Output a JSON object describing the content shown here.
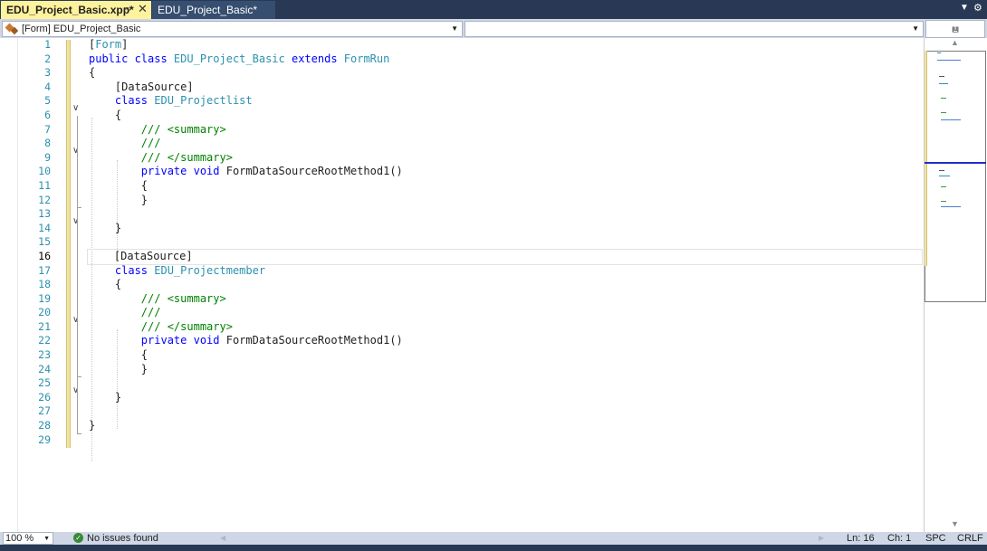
{
  "tabs": [
    {
      "label": "EDU_Project_Basic.xpp*",
      "active": true,
      "pin_icon": "pin-icon",
      "close_icon": "close-icon"
    },
    {
      "label": "EDU_Project_Basic*",
      "active": false
    }
  ],
  "tabstrip": {
    "menu_icon": "dropdown-arrow-icon",
    "settings_icon": "gear-icon"
  },
  "navbar": {
    "left_combo": "[Form] EDU_Project_Basic",
    "right_combo": "",
    "split_icon": "split-window-icon"
  },
  "editor": {
    "current_line": 16,
    "lines": [
      {
        "n": "1",
        "tokens": [
          {
            "t": "[",
            "c": "br"
          },
          {
            "t": "Form",
            "c": "ty"
          },
          {
            "t": "]",
            "c": "br"
          }
        ]
      },
      {
        "n": "2",
        "tokens": [
          {
            "t": "public class ",
            "c": "kw"
          },
          {
            "t": "EDU_Project_Basic",
            "c": "ty"
          },
          {
            "t": " extends ",
            "c": "kw"
          },
          {
            "t": "FormRun",
            "c": "ty"
          }
        ]
      },
      {
        "n": "3",
        "tokens": [
          {
            "t": "{",
            "c": "br"
          }
        ]
      },
      {
        "n": "4",
        "tokens": [
          {
            "t": "    [DataSource]",
            "c": "br"
          }
        ]
      },
      {
        "n": "5",
        "tokens": [
          {
            "t": "    class ",
            "c": "kw"
          },
          {
            "t": "EDU_Projectlist",
            "c": "ty"
          }
        ]
      },
      {
        "n": "6",
        "tokens": [
          {
            "t": "    {",
            "c": "br"
          }
        ]
      },
      {
        "n": "7",
        "tokens": [
          {
            "t": "        /// <summary>",
            "c": "cm"
          }
        ]
      },
      {
        "n": "8",
        "tokens": [
          {
            "t": "        ///",
            "c": "cm"
          }
        ]
      },
      {
        "n": "9",
        "tokens": [
          {
            "t": "        /// </summary>",
            "c": "cm"
          }
        ]
      },
      {
        "n": "10",
        "tokens": [
          {
            "t": "        private void ",
            "c": "kw"
          },
          {
            "t": "FormDataSourceRootMethod1()",
            "c": "br"
          }
        ]
      },
      {
        "n": "11",
        "tokens": [
          {
            "t": "        {",
            "c": "br"
          }
        ]
      },
      {
        "n": "12",
        "tokens": [
          {
            "t": "        }",
            "c": "br"
          }
        ]
      },
      {
        "n": "13",
        "tokens": []
      },
      {
        "n": "14",
        "tokens": [
          {
            "t": "    }",
            "c": "br"
          }
        ]
      },
      {
        "n": "15",
        "tokens": []
      },
      {
        "n": "16",
        "tokens": [
          {
            "t": "    [DataSource]",
            "c": "br"
          }
        ]
      },
      {
        "n": "17",
        "tokens": [
          {
            "t": "    class ",
            "c": "kw"
          },
          {
            "t": "EDU_Projectmember",
            "c": "ty"
          }
        ]
      },
      {
        "n": "18",
        "tokens": [
          {
            "t": "    {",
            "c": "br"
          }
        ]
      },
      {
        "n": "19",
        "tokens": [
          {
            "t": "        /// <summary>",
            "c": "cm"
          }
        ]
      },
      {
        "n": "20",
        "tokens": [
          {
            "t": "        ///",
            "c": "cm"
          }
        ]
      },
      {
        "n": "21",
        "tokens": [
          {
            "t": "        /// </summary>",
            "c": "cm"
          }
        ]
      },
      {
        "n": "22",
        "tokens": [
          {
            "t": "        private void ",
            "c": "kw"
          },
          {
            "t": "FormDataSourceRootMethod1()",
            "c": "br"
          }
        ]
      },
      {
        "n": "23",
        "tokens": [
          {
            "t": "        {",
            "c": "br"
          }
        ]
      },
      {
        "n": "24",
        "tokens": [
          {
            "t": "        }",
            "c": "br"
          }
        ]
      },
      {
        "n": "25",
        "tokens": []
      },
      {
        "n": "26",
        "tokens": [
          {
            "t": "    }",
            "c": "br"
          }
        ]
      },
      {
        "n": "27",
        "tokens": []
      },
      {
        "n": "28",
        "tokens": [
          {
            "t": "}",
            "c": "br"
          }
        ]
      },
      {
        "n": "29",
        "tokens": []
      }
    ]
  },
  "statusbar": {
    "zoom": "100 %",
    "issues_icon": "check-circle-icon",
    "issues_text": "No issues found",
    "line": "Ln: 16",
    "column": "Ch: 1",
    "whitespace": "SPC",
    "line_endings": "CRLF"
  },
  "colors": {
    "keyword": "#0000ff",
    "type": "#2b91af",
    "comment": "#008000",
    "active_tab": "#fff29d",
    "chrome": "#293955"
  }
}
